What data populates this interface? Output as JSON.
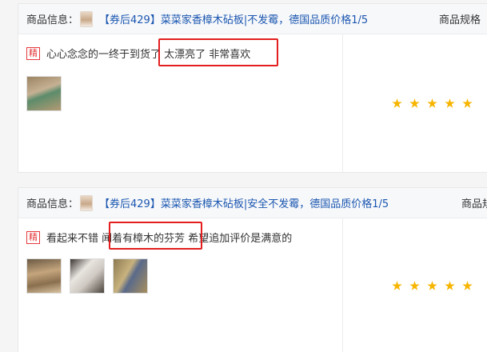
{
  "reviews": [
    {
      "info_label": "商品信息：",
      "product_title": "【券后429】菜菜家香樟木砧板|不发霉，德国品质价格1/5",
      "spec_label": "商品规格",
      "tag": "精",
      "text": "心心念念的一终于到货了 太漂亮了 非常喜欢",
      "highlighted_phrase": "太漂亮了 非常喜欢",
      "photo_count": 1,
      "rating": 5
    },
    {
      "info_label": "商品信息：",
      "product_title": "【券后429】菜菜家香樟木砧板|安全不发霉，德国品质价格1/5",
      "spec_label": "商品规",
      "tag": "精",
      "text": "看起来不错 闻着有樟木的芬芳 希望追加评价是满意的",
      "highlighted_phrase": "闻着有樟木的芬芳",
      "photo_count": 3,
      "rating": 5
    }
  ],
  "colors": {
    "link": "#1a56b0",
    "tag": "#e4393c",
    "highlight_box": "#e41e1e",
    "star": "#f7b500"
  }
}
